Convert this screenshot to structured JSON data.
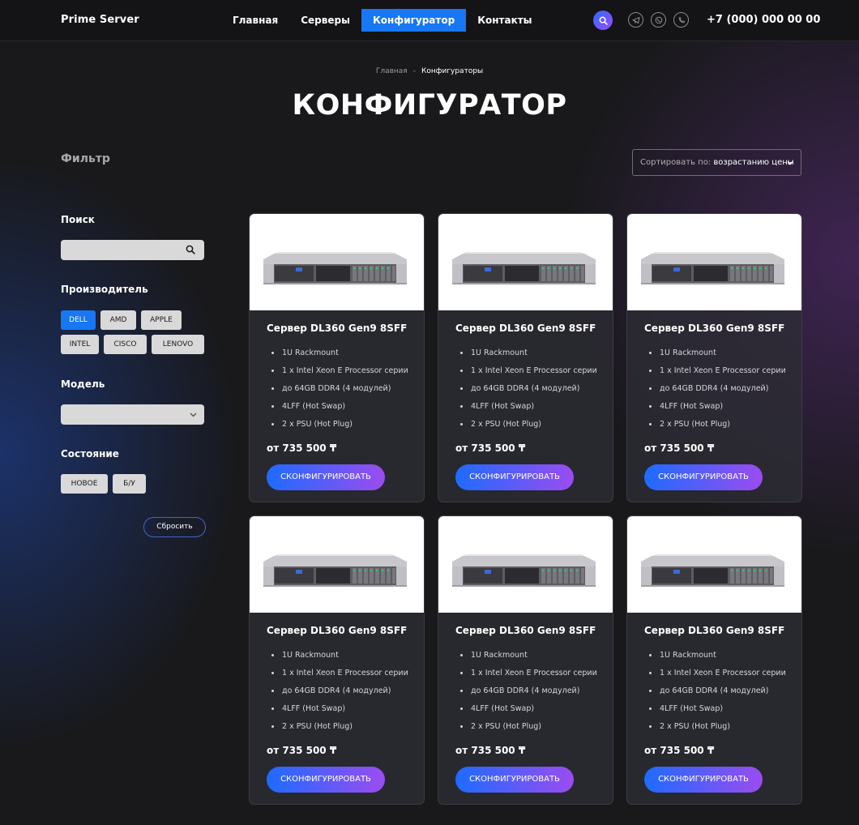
{
  "header": {
    "logo": "Prime Server",
    "nav": [
      {
        "label": "Главная"
      },
      {
        "label": "Серверы"
      },
      {
        "label": "Конфигуратор"
      },
      {
        "label": "Контакты"
      }
    ],
    "phone": "+7 (000) 000 00 00"
  },
  "breadcrumb": {
    "home": "Главная",
    "sep": "-",
    "current": "Конфигураторы"
  },
  "page_title": "КОНФИГУРАТОР",
  "filter": {
    "title": "Фильтр",
    "search_label": "Поиск",
    "search_value": "",
    "manufacturer_label": "Производитель",
    "manufacturers": [
      "DELL",
      "AMD",
      "APPLE",
      "INTEL",
      "CISCO",
      "LENOVO"
    ],
    "model_label": "Модель",
    "model_value": "",
    "condition_label": "Состояние",
    "conditions": [
      "НОВОЕ",
      "Б/У"
    ],
    "reset_label": "Сбросить"
  },
  "sort": {
    "prefix": "Сортировать по:",
    "value": "возрастанию цены"
  },
  "products": [
    {
      "name": "Сервер DL360 Gen9 8SFF",
      "specs": [
        "1U Rackmount",
        "1 x Intel Xeon E Processor серии",
        "до 64GB DDR4 (4 модулей)",
        "4LFF (Hot Swap)",
        "2 x PSU (Hot Plug)"
      ],
      "price": "от 735 500 ₸",
      "button": "СКОНФИГУРИРОВАТЬ"
    },
    {
      "name": "Сервер DL360 Gen9 8SFF",
      "specs": [
        "1U Rackmount",
        "1 x Intel Xeon E Processor серии",
        "до 64GB DDR4 (4 модулей)",
        "4LFF (Hot Swap)",
        "2 x PSU (Hot Plug)"
      ],
      "price": "от 735 500 ₸",
      "button": "СКОНФИГУРИРОВАТЬ"
    },
    {
      "name": "Сервер DL360 Gen9 8SFF",
      "specs": [
        "1U Rackmount",
        "1 x Intel Xeon E Processor серии",
        "до 64GB DDR4 (4 модулей)",
        "4LFF (Hot Swap)",
        "2 x PSU (Hot Plug)"
      ],
      "price": "от 735 500 ₸",
      "button": "СКОНФИГУРИРОВАТЬ"
    },
    {
      "name": "Сервер DL360 Gen9 8SFF",
      "specs": [
        "1U Rackmount",
        "1 x Intel Xeon E Processor серии",
        "до 64GB DDR4 (4 модулей)",
        "4LFF (Hot Swap)",
        "2 x PSU (Hot Plug)"
      ],
      "price": "от 735 500 ₸",
      "button": "СКОНФИГУРИРОВАТЬ"
    },
    {
      "name": "Сервер DL360 Gen9 8SFF",
      "specs": [
        "1U Rackmount",
        "1 x Intel Xeon E Processor серии",
        "до 64GB DDR4 (4 модулей)",
        "4LFF (Hot Swap)",
        "2 x PSU (Hot Plug)"
      ],
      "price": "от 735 500 ₸",
      "button": "СКОНФИГУРИРОВАТЬ"
    },
    {
      "name": "Сервер DL360 Gen9 8SFF",
      "specs": [
        "1U Rackmount",
        "1 x Intel Xeon E Processor серии",
        "до 64GB DDR4 (4 модулей)",
        "4LFF (Hot Swap)",
        "2 x PSU (Hot Plug)"
      ],
      "price": "от 735 500 ₸",
      "button": "СКОНФИГУРИРОВАТЬ"
    }
  ],
  "colors": {
    "accent": "#1877f2",
    "gradient_start": "#1e6bff",
    "gradient_end": "#9b4cf0",
    "background": "#19191c"
  },
  "icons": [
    "search-icon",
    "telegram-icon",
    "whatsapp-icon",
    "phone-icon",
    "chevron-down-icon",
    "server-image"
  ]
}
